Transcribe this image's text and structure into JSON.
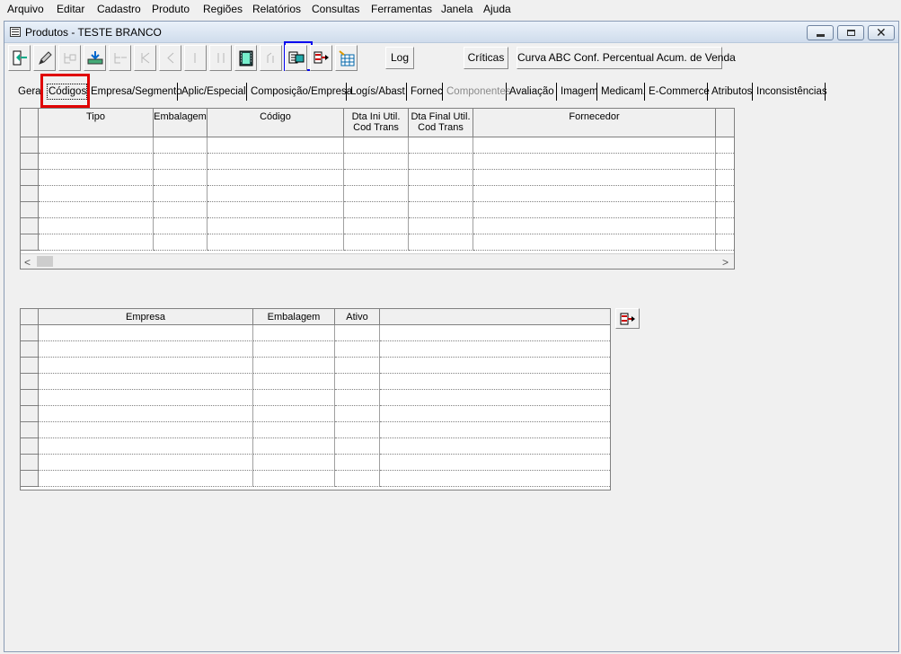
{
  "menubar": {
    "items": [
      {
        "label": "Arquivo"
      },
      {
        "label": "Editar"
      },
      {
        "label": "Cadastro"
      },
      {
        "label": "Produto"
      },
      {
        "label": "Regiões"
      },
      {
        "label": "Relatórios"
      },
      {
        "label": "Consultas"
      },
      {
        "label": "Ferramentas"
      },
      {
        "label": "Janela"
      },
      {
        "label": "Ajuda"
      }
    ]
  },
  "window": {
    "title": "Produtos - TESTE BRANCO",
    "icon": "form-icon"
  },
  "toolbar": {
    "icon_buttons": [
      {
        "name": "exit-icon",
        "enabled": true
      },
      {
        "name": "pencil-icon",
        "enabled": true
      },
      {
        "name": "tree-add-icon",
        "enabled": false
      },
      {
        "name": "save-tray-icon",
        "enabled": true
      },
      {
        "name": "tree-remove-icon",
        "enabled": false
      },
      {
        "name": "first-icon",
        "enabled": false
      },
      {
        "name": "prev-icon",
        "enabled": false
      },
      {
        "name": "next-icon",
        "enabled": false
      },
      {
        "name": "last-icon",
        "enabled": false
      },
      {
        "name": "film-icon",
        "enabled": true
      },
      {
        "name": "undo-icon",
        "enabled": false
      },
      {
        "name": "link-record-icon",
        "enabled": true
      },
      {
        "name": "import-icon",
        "enabled": true
      },
      {
        "name": "grid-wand-icon",
        "enabled": true
      }
    ],
    "log_label": "Log",
    "criticas_label": "Críticas",
    "curva_label": "Curva ABC Conf. Percentual Acum. de Venda"
  },
  "tabs": [
    {
      "label": "Gera"
    },
    {
      "label": "Códigos",
      "active": true
    },
    {
      "label": "Empresa/Segmento"
    },
    {
      "label": "Aplic/Especial"
    },
    {
      "label": "Composição/Empresa"
    },
    {
      "label": "Logís/Abast"
    },
    {
      "label": "Fornec"
    },
    {
      "label": "Componentes",
      "disabled": true
    },
    {
      "label": "Avaliação"
    },
    {
      "label": "Imagem"
    },
    {
      "label": "Medicam."
    },
    {
      "label": "E-Commerce"
    },
    {
      "label": "Atributos"
    },
    {
      "label": "Inconsistências"
    }
  ],
  "grid_codigos": {
    "columns": [
      "Tipo",
      "Embalagem",
      "Código",
      "Dta Ini Util. Cod Trans",
      "Dta Final Util. Cod Trans",
      "Fornecedor",
      ""
    ],
    "column_lines": [
      [
        "Tipo"
      ],
      [
        "Embalagem"
      ],
      [
        "Código"
      ],
      [
        "Dta Ini Util.",
        "Cod Trans"
      ],
      [
        "Dta Final Util.",
        "Cod Trans"
      ],
      [
        "Fornecedor"
      ],
      [
        ""
      ]
    ],
    "rows": 7
  },
  "grid_empresa": {
    "columns": [
      "Empresa",
      "Embalagem",
      "Ativo",
      ""
    ],
    "rows": 10
  },
  "side_button": {
    "name": "import-icon"
  }
}
